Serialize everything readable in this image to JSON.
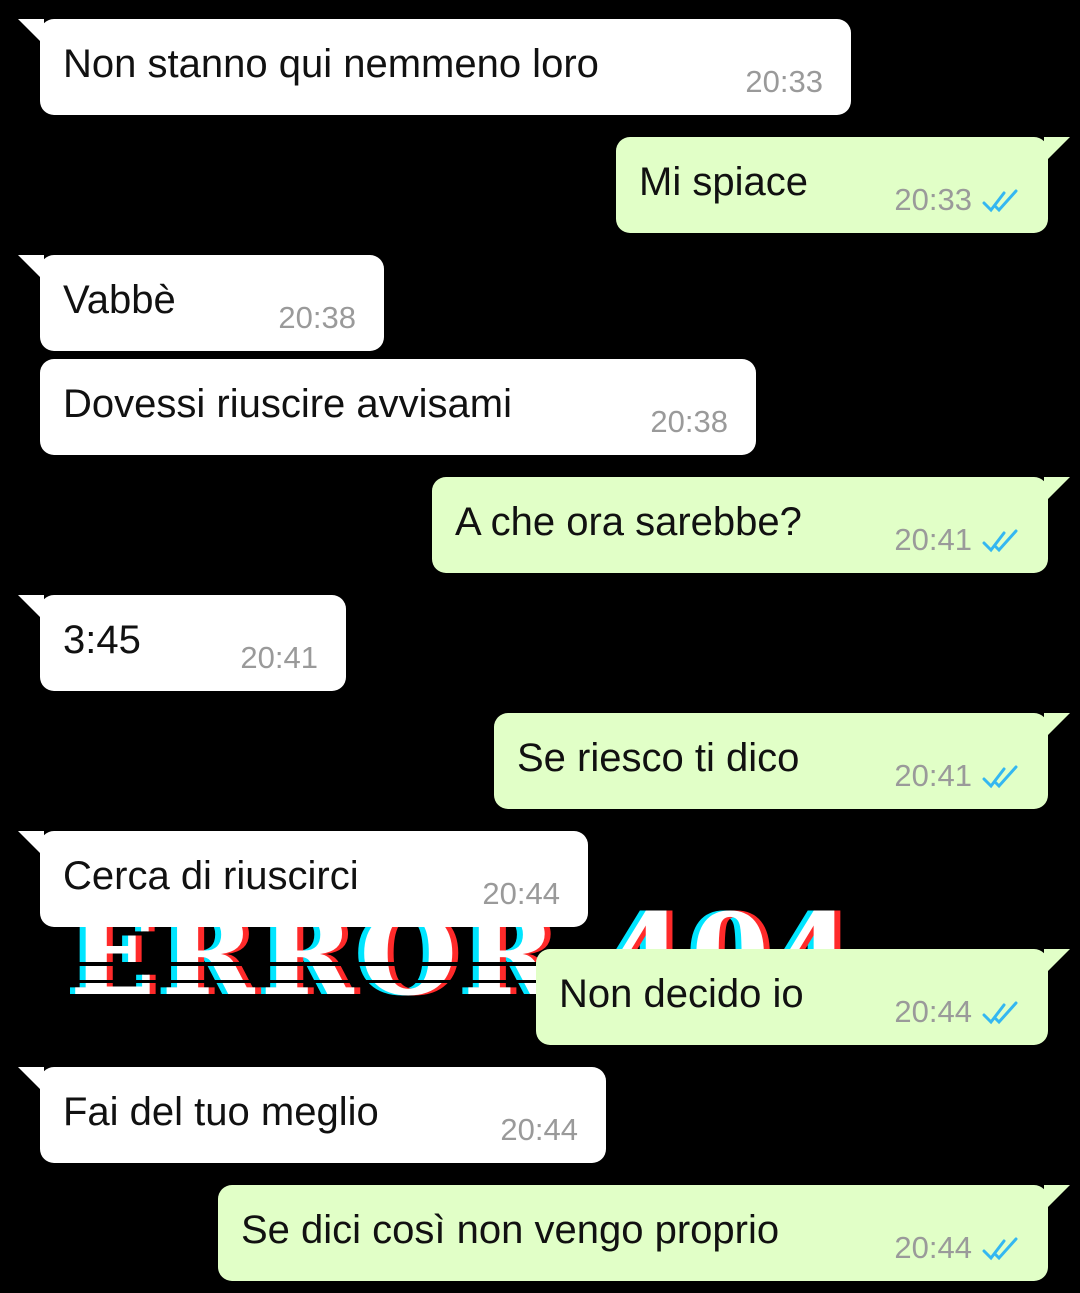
{
  "wallpaper": {
    "text": "ERROR 404",
    "colors": {
      "cyan": "#00e5ff",
      "red": "#ff2a2a",
      "white": "#ffffff"
    }
  },
  "colors": {
    "background": "#000000",
    "incoming_bubble": "#ffffff",
    "outgoing_bubble": "#e1ffc7",
    "read_ticks": "#34b7f1",
    "timestamp": "#9a9a9a"
  },
  "messages": [
    {
      "direction": "in",
      "text": "Non stanno qui nemmeno loro",
      "time": "20:33"
    },
    {
      "direction": "out",
      "text": "Mi spiace",
      "time": "20:33",
      "status": "read"
    },
    {
      "direction": "in",
      "text": "Vabbè",
      "time": "20:38"
    },
    {
      "direction": "in",
      "text": "Dovessi riuscire avvisami",
      "time": "20:38"
    },
    {
      "direction": "out",
      "text": "A che ora sarebbe?",
      "time": "20:41",
      "status": "read"
    },
    {
      "direction": "in",
      "text": "3:45",
      "time": "20:41"
    },
    {
      "direction": "out",
      "text": "Se riesco ti dico",
      "time": "20:41",
      "status": "read"
    },
    {
      "direction": "in",
      "text": "Cerca di riuscirci",
      "time": "20:44"
    },
    {
      "direction": "out",
      "text": "Non decido io",
      "time": "20:44",
      "status": "read"
    },
    {
      "direction": "in",
      "text": "Fai del tuo meglio",
      "time": "20:44"
    },
    {
      "direction": "out",
      "text": "Se dici così non vengo proprio",
      "time": "20:44",
      "status": "read"
    }
  ]
}
